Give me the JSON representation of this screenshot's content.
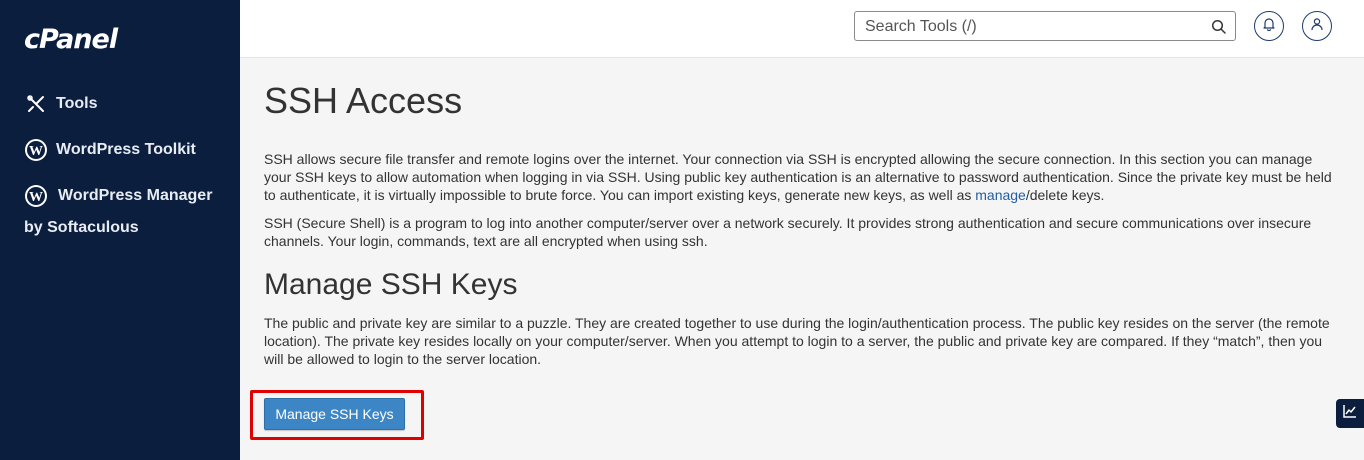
{
  "sidebar": {
    "logo": "cPanel",
    "items": [
      {
        "label": "Tools",
        "icon": "tools-icon"
      },
      {
        "label": "WordPress Toolkit",
        "icon": "wordpress-icon"
      },
      {
        "label": "WordPress Manager",
        "label_line2": "by Softaculous",
        "icon": "wordpress-icon"
      }
    ]
  },
  "topbar": {
    "search_placeholder": "Search Tools (/)"
  },
  "page": {
    "title": "SSH Access",
    "intro_1_before_link": "SSH allows secure file transfer and remote logins over the internet. Your connection via SSH is encrypted allowing the secure connection. In this section you can manage your SSH keys to allow automation when logging in via SSH. Using public key authentication is an alternative to password authentication. Since the private key must be held to authenticate, it is virtually impossible to brute force. You can import existing keys, generate new keys, as well as ",
    "intro_1_link": "manage",
    "intro_1_after_link": "/delete keys.",
    "intro_2": "SSH (Secure Shell) is a program to log into another computer/server over a network securely. It provides strong authentication and secure communications over insecure channels. Your login, commands, text are all encrypted when using ssh.",
    "section_title": "Manage SSH Keys",
    "section_text": "The public and private key are similar to a puzzle. They are created together to use during the login/authentication process. The public key resides on the server (the remote location). The private key resides locally on your computer/server. When you attempt to login to a server, the public and private key are compared. If they “match”, then you will be allowed to login to the server location.",
    "button_label": "Manage SSH Keys"
  },
  "colors": {
    "sidebar_bg": "#0c1e3e",
    "button_bg": "#3d86c6",
    "highlight_border": "#e00000",
    "link": "#1f5fa6"
  }
}
